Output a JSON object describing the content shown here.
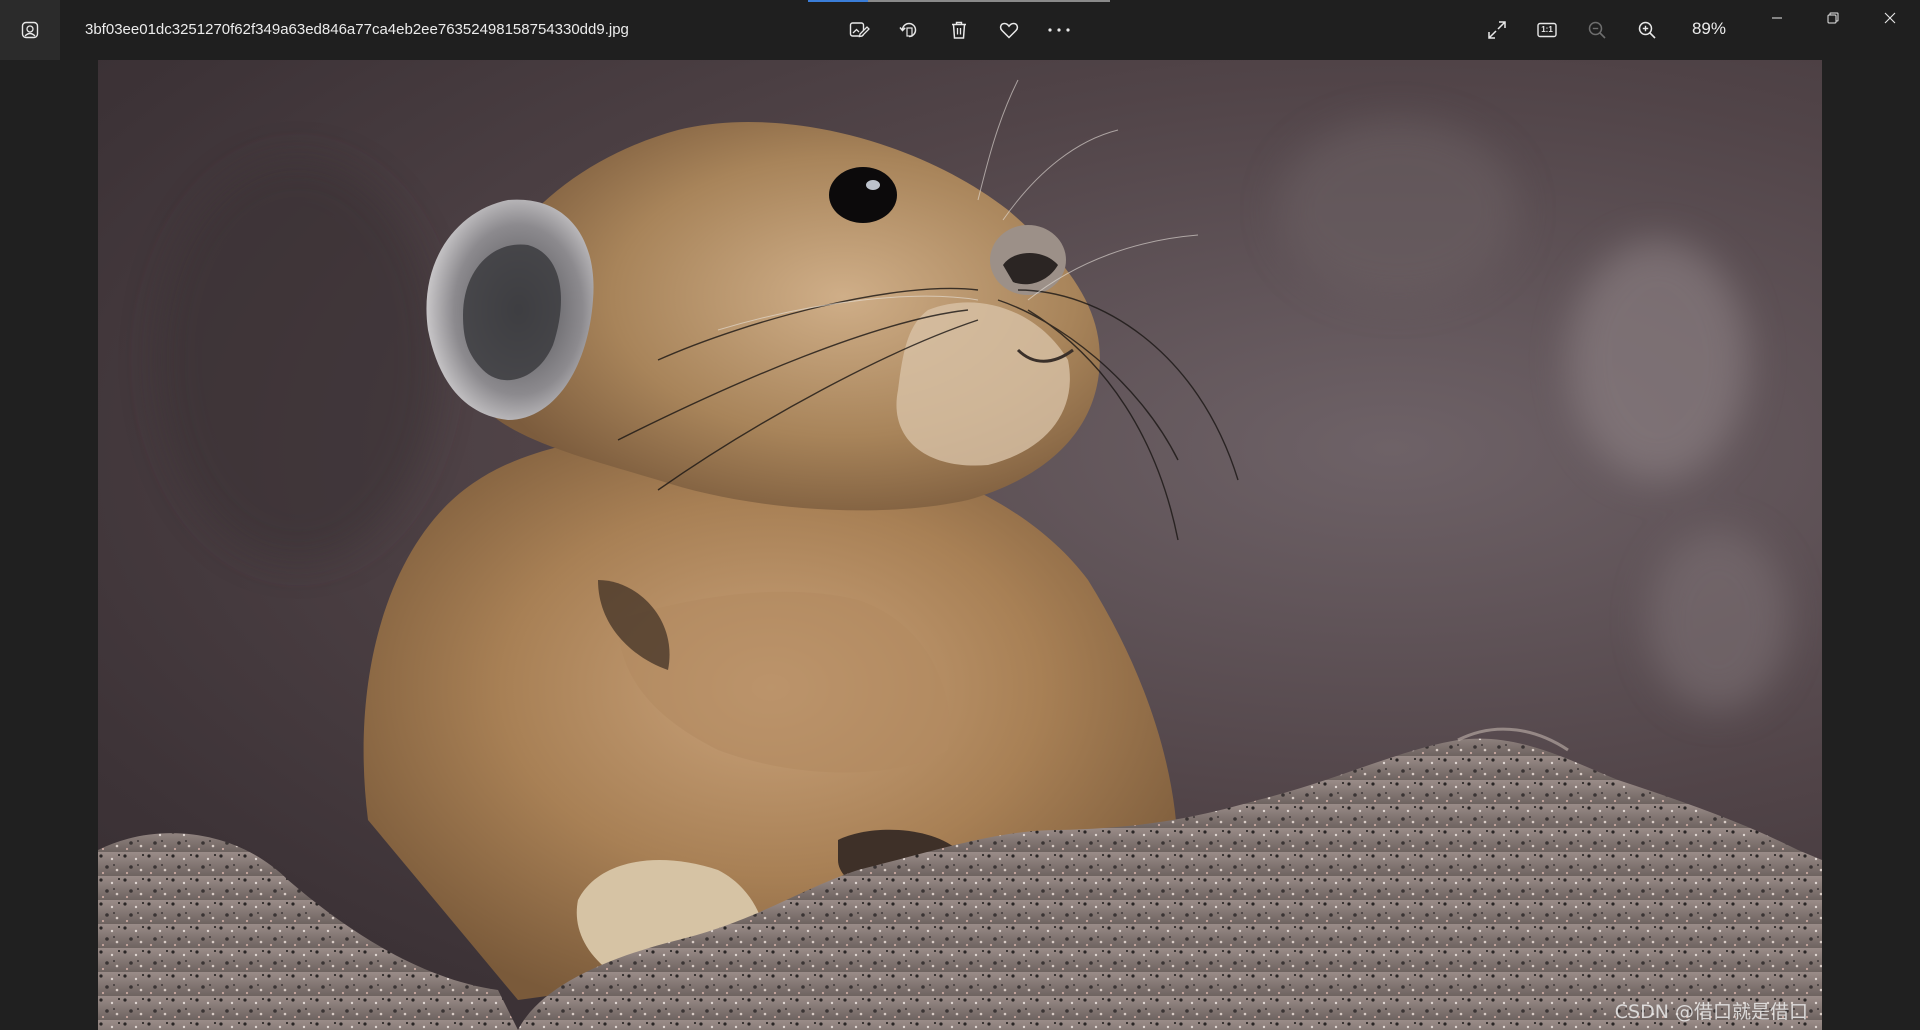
{
  "window": {
    "file_name": "3bf03ee01dc3251270f62f349a63ed846a77ca4eb2ee76352498158754330dd9.jpg",
    "app_icon": "photos-app-icon"
  },
  "toolbar": {
    "edit_icon": "edit-image-icon",
    "rotate_icon": "rotate-icon",
    "delete_icon": "trash-icon",
    "favorite_icon": "heart-icon",
    "more_icon": "more-dots-icon"
  },
  "view_controls": {
    "fullscreen_icon": "expand-icon",
    "actual_size_icon": "actual-size-icon",
    "actual_size_label": "1:1",
    "zoom_out_icon": "zoom-out-icon",
    "zoom_in_icon": "zoom-in-icon",
    "zoom_level": "89%"
  },
  "window_controls": {
    "minimize_icon": "minimize-icon",
    "restore_icon": "restore-icon",
    "close_icon": "close-icon"
  },
  "image": {
    "subject": "pika",
    "watermark": "CSDN @借口就是借口"
  },
  "colors": {
    "titlebar_bg": "#1f1f1f",
    "accent": "#3a7dd8"
  }
}
